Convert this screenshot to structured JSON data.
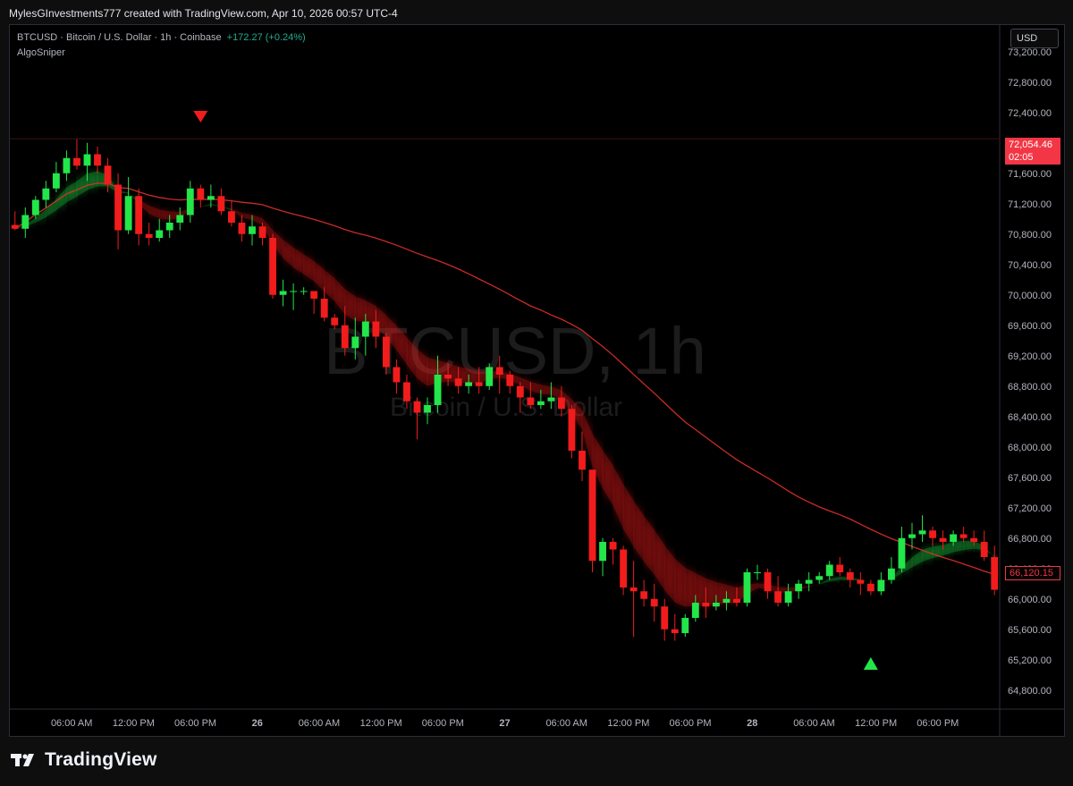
{
  "header": {
    "credit": "MylesGInvestments777 created with TradingView.com, Apr 10, 2026 00:57 UTC-4"
  },
  "symbol": {
    "line": "BTCUSD · Bitcoin / U.S. Dollar · 1h · Coinbase",
    "change": "+172.27 (+0.24%)",
    "indicator": "AlgoSniper"
  },
  "watermark": {
    "ticker": "BTCUSD, 1h",
    "name": "Bitcoin / U.S. Dollar"
  },
  "price_axis": {
    "currency": "USD"
  },
  "current_price": {
    "value": "72,054.46",
    "countdown": "02:05"
  },
  "last_price_label": "66,120.15",
  "colors": {
    "bull": "#22e64a",
    "bear": "#f21c1c",
    "background": "#000000",
    "long_ma": "#e0302a",
    "long_ma_bull": "#2fbf3a"
  },
  "footer": {
    "brand": "TradingView"
  },
  "chart_data": {
    "type": "candlestick",
    "y_ticks": [
      "73,200.00",
      "72,800.00",
      "72,400.00",
      "72,000.00",
      "71,600.00",
      "71,200.00",
      "70,800.00",
      "70,400.00",
      "70,000.00",
      "69,600.00",
      "69,200.00",
      "68,800.00",
      "68,400.00",
      "68,000.00",
      "67,600.00",
      "67,200.00",
      "66,800.00",
      "66,400.00",
      "66,000.00",
      "65,600.00",
      "65,200.00",
      "64,800.00"
    ],
    "ylim": [
      64550,
      73550
    ],
    "x_ticks": [
      {
        "i": 5.5,
        "label": "06:00 AM"
      },
      {
        "i": 11.5,
        "label": "12:00 PM"
      },
      {
        "i": 17.5,
        "label": "06:00 PM"
      },
      {
        "i": 23.5,
        "label": "26"
      },
      {
        "i": 29.5,
        "label": "06:00 AM"
      },
      {
        "i": 35.5,
        "label": "12:00 PM"
      },
      {
        "i": 41.5,
        "label": "06:00 PM"
      },
      {
        "i": 47.5,
        "label": "27"
      },
      {
        "i": 53.5,
        "label": "06:00 AM"
      },
      {
        "i": 59.5,
        "label": "12:00 PM"
      },
      {
        "i": 65.5,
        "label": "06:00 PM"
      },
      {
        "i": 71.5,
        "label": "28"
      },
      {
        "i": 77.5,
        "label": "06:00 AM"
      },
      {
        "i": 83.5,
        "label": "12:00 PM"
      },
      {
        "i": 89.5,
        "label": "06:00 PM"
      }
    ],
    "candles": [
      [
        70920,
        71100,
        70850,
        70870
      ],
      [
        70870,
        71150,
        70750,
        71050
      ],
      [
        71050,
        71300,
        71000,
        71250
      ],
      [
        71250,
        71500,
        71150,
        71400
      ],
      [
        71400,
        71750,
        71350,
        71600
      ],
      [
        71600,
        71900,
        71500,
        71800
      ],
      [
        71800,
        72050,
        71650,
        71700
      ],
      [
        71700,
        72000,
        71500,
        71850
      ],
      [
        71850,
        71950,
        71600,
        71700
      ],
      [
        71700,
        71800,
        71350,
        71450
      ],
      [
        71450,
        71600,
        70600,
        70850
      ],
      [
        70850,
        71550,
        70800,
        71300
      ],
      [
        71300,
        71400,
        70650,
        70800
      ],
      [
        70800,
        70950,
        70650,
        70750
      ],
      [
        70750,
        71000,
        70700,
        70850
      ],
      [
        70850,
        71050,
        70750,
        70950
      ],
      [
        70950,
        71150,
        70850,
        71050
      ],
      [
        71050,
        71500,
        70950,
        71400
      ],
      [
        71400,
        71450,
        71150,
        71250
      ],
      [
        71250,
        71450,
        71150,
        71300
      ],
      [
        71300,
        71400,
        71050,
        71100
      ],
      [
        71100,
        71250,
        70900,
        70950
      ],
      [
        70950,
        71050,
        70700,
        70800
      ],
      [
        70800,
        71050,
        70650,
        70900
      ],
      [
        70900,
        70950,
        70650,
        70750
      ],
      [
        70750,
        70800,
        69950,
        70000
      ],
      [
        70000,
        70200,
        69850,
        70050
      ],
      [
        70050,
        70150,
        69800,
        70050
      ],
      [
        70050,
        70100,
        70000,
        70050
      ],
      [
        70050,
        70000,
        69750,
        69950
      ],
      [
        69950,
        70100,
        69650,
        69700
      ],
      [
        69700,
        69750,
        69550,
        69600
      ],
      [
        69600,
        69850,
        69200,
        69300
      ],
      [
        69300,
        69700,
        69150,
        69450
      ],
      [
        69450,
        69750,
        69200,
        69650
      ],
      [
        69650,
        69800,
        69300,
        69450
      ],
      [
        69450,
        69500,
        68950,
        69050
      ],
      [
        69050,
        69150,
        68700,
        68850
      ],
      [
        68850,
        68950,
        68500,
        68600
      ],
      [
        68600,
        68650,
        68100,
        68450
      ],
      [
        68450,
        68650,
        68300,
        68550
      ],
      [
        68550,
        69200,
        68450,
        68950
      ],
      [
        68950,
        69100,
        68800,
        68900
      ],
      [
        68900,
        69050,
        68700,
        68800
      ],
      [
        68800,
        68950,
        68700,
        68850
      ],
      [
        68850,
        69050,
        68700,
        68800
      ],
      [
        68800,
        69100,
        68750,
        69050
      ],
      [
        69050,
        69200,
        68700,
        68950
      ],
      [
        68950,
        69000,
        68700,
        68800
      ],
      [
        68800,
        68850,
        68450,
        68650
      ],
      [
        68650,
        68850,
        68500,
        68550
      ],
      [
        68550,
        68750,
        68500,
        68600
      ],
      [
        68600,
        68850,
        68500,
        68650
      ],
      [
        68650,
        68800,
        68400,
        68500
      ],
      [
        68500,
        68550,
        67850,
        67950
      ],
      [
        67950,
        68200,
        67550,
        67700
      ],
      [
        67700,
        67700,
        66350,
        66500
      ],
      [
        66500,
        66800,
        66300,
        66750
      ],
      [
        66750,
        66800,
        66450,
        66650
      ],
      [
        66650,
        66700,
        66050,
        66150
      ],
      [
        66150,
        66500,
        65500,
        66100
      ],
      [
        66100,
        66250,
        65900,
        66000
      ],
      [
        66000,
        66200,
        65700,
        65900
      ],
      [
        65900,
        66000,
        65450,
        65600
      ],
      [
        65600,
        65800,
        65450,
        65550
      ],
      [
        65550,
        65800,
        65500,
        65750
      ],
      [
        65750,
        66050,
        65700,
        65950
      ],
      [
        65950,
        66150,
        65750,
        65900
      ],
      [
        65900,
        66050,
        65850,
        65950
      ],
      [
        65950,
        66100,
        65850,
        66000
      ],
      [
        66000,
        66150,
        65900,
        65950
      ],
      [
        65950,
        66400,
        65900,
        66350
      ],
      [
        66350,
        66450,
        66250,
        66350
      ],
      [
        66350,
        66400,
        66000,
        66100
      ],
      [
        66100,
        66300,
        65900,
        65950
      ],
      [
        65950,
        66200,
        65900,
        66100
      ],
      [
        66100,
        66250,
        66000,
        66200
      ],
      [
        66200,
        66350,
        66100,
        66250
      ],
      [
        66250,
        66350,
        66200,
        66300
      ],
      [
        66300,
        66500,
        66250,
        66450
      ],
      [
        66450,
        66550,
        66300,
        66350
      ],
      [
        66350,
        66400,
        66150,
        66250
      ],
      [
        66250,
        66350,
        66050,
        66200
      ],
      [
        66200,
        66250,
        66050,
        66100
      ],
      [
        66100,
        66350,
        66050,
        66250
      ],
      [
        66250,
        66550,
        66200,
        66400
      ],
      [
        66400,
        66950,
        66350,
        66800
      ],
      [
        66800,
        67000,
        66650,
        66850
      ],
      [
        66850,
        67100,
        66750,
        66900
      ],
      [
        66900,
        66950,
        66700,
        66800
      ],
      [
        66800,
        66900,
        66650,
        66750
      ],
      [
        66750,
        66900,
        66700,
        66850
      ],
      [
        66850,
        66950,
        66750,
        66800
      ],
      [
        66800,
        66900,
        66700,
        66750
      ],
      [
        66750,
        66900,
        66500,
        66550
      ],
      [
        66550,
        66700,
        66050,
        66120
      ]
    ],
    "signals": [
      {
        "type": "sell",
        "i": 18,
        "price": 72350
      },
      {
        "type": "buy",
        "i": 83,
        "price": 65150
      }
    ]
  }
}
